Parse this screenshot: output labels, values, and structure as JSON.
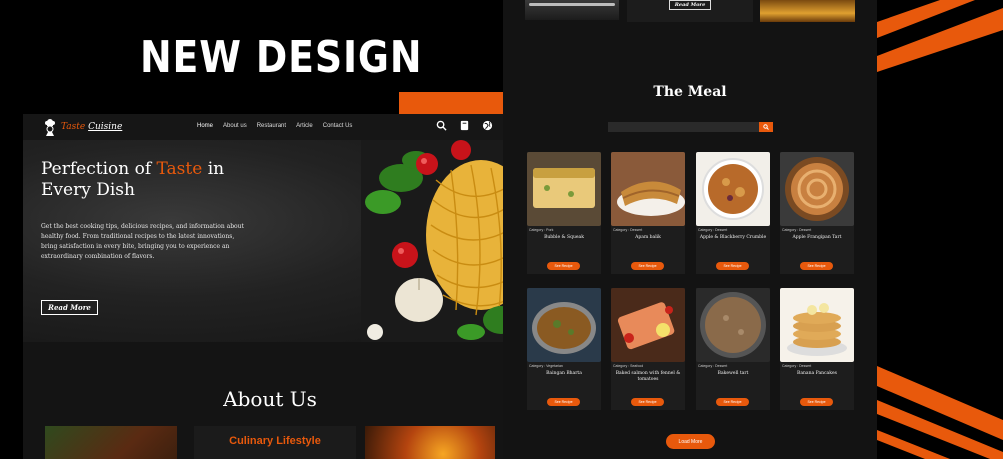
{
  "headline": "NEW DESIGN",
  "colors": {
    "accent": "#e8590c",
    "background": "#000000",
    "panel": "#141414"
  },
  "site": {
    "logo": {
      "name_part1": "Taste",
      "name_part2": "Cuisine",
      "icon": "chef-icon"
    },
    "nav": [
      "Home",
      "About us",
      "Restaurant",
      "Article",
      "Contact Us"
    ],
    "nav_icons": [
      "search-icon",
      "book-icon",
      "globe-icon"
    ],
    "hero": {
      "title_part1": "Perfection of ",
      "title_accent": "Taste",
      "title_part2": " in Every Dish",
      "description": "Get the best cooking tips, delicious recipes, and information about healthy food. From traditional recipes to the latest innovations, bring satisfaction in every bite, bringing you to experience an extraordinary combination of flavors.",
      "button": "Read More"
    },
    "about": {
      "title": "About Us",
      "card_title": "Culinary Lifestyle"
    }
  },
  "meal_page": {
    "top_button": "Read More",
    "title": "The Meal",
    "search_placeholder": "",
    "meals": [
      {
        "category": "Category : Pork",
        "name": "Bubble & Squeak",
        "button": "See Recipe"
      },
      {
        "category": "Category : Dessert",
        "name": "Apam balik",
        "button": "See Recipe"
      },
      {
        "category": "Category : Dessert",
        "name": "Apple & Blackberry Crumble",
        "button": "See Recipe"
      },
      {
        "category": "Category : Dessert",
        "name": "Apple Frangipan Tart",
        "button": "See Recipe"
      },
      {
        "category": "Category : Vegetarian",
        "name": "Baingan Bharta",
        "button": "See Recipe"
      },
      {
        "category": "Category : Seafood",
        "name": "Baked salmon with fennel & tomatoes",
        "button": "See Recipe"
      },
      {
        "category": "Category : Dessert",
        "name": "Bakewell tart",
        "button": "See Recipe"
      },
      {
        "category": "Category : Dessert",
        "name": "Banana Pancakes",
        "button": "See Recipe"
      }
    ],
    "load_more": "Load More"
  }
}
